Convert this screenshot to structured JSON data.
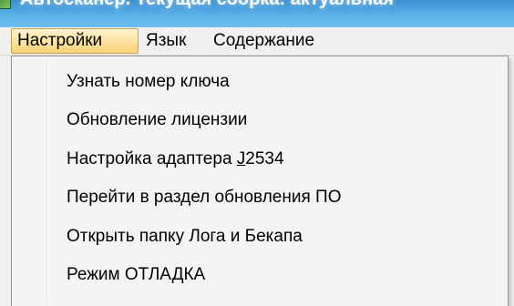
{
  "window": {
    "title": "Автосканер. Текущая сборка: актуальная",
    "icon": "app-icon"
  },
  "menubar": {
    "items": [
      {
        "label": "Настройки",
        "active": true
      },
      {
        "label": "Язык",
        "active": false
      },
      {
        "label": "Содержание",
        "active": false
      }
    ]
  },
  "dropdown": {
    "items": [
      {
        "label": "Узнать номер ключа"
      },
      {
        "label": "Обновление лицензии"
      },
      {
        "label_pre": "Настройка адаптера ",
        "label_accel": "J",
        "label_post": "2534"
      },
      {
        "label": "Перейти в раздел обновления ПО"
      },
      {
        "label": "Открыть папку Лога и Бекапа"
      },
      {
        "label": "Режим ОТЛАДКА"
      }
    ]
  },
  "colors": {
    "menu_active_bg": "#fbe3a0",
    "menu_active_border": "#c9a44a",
    "dropdown_bg": "#f4f4f4",
    "titlebar": "#3a8fd0"
  }
}
